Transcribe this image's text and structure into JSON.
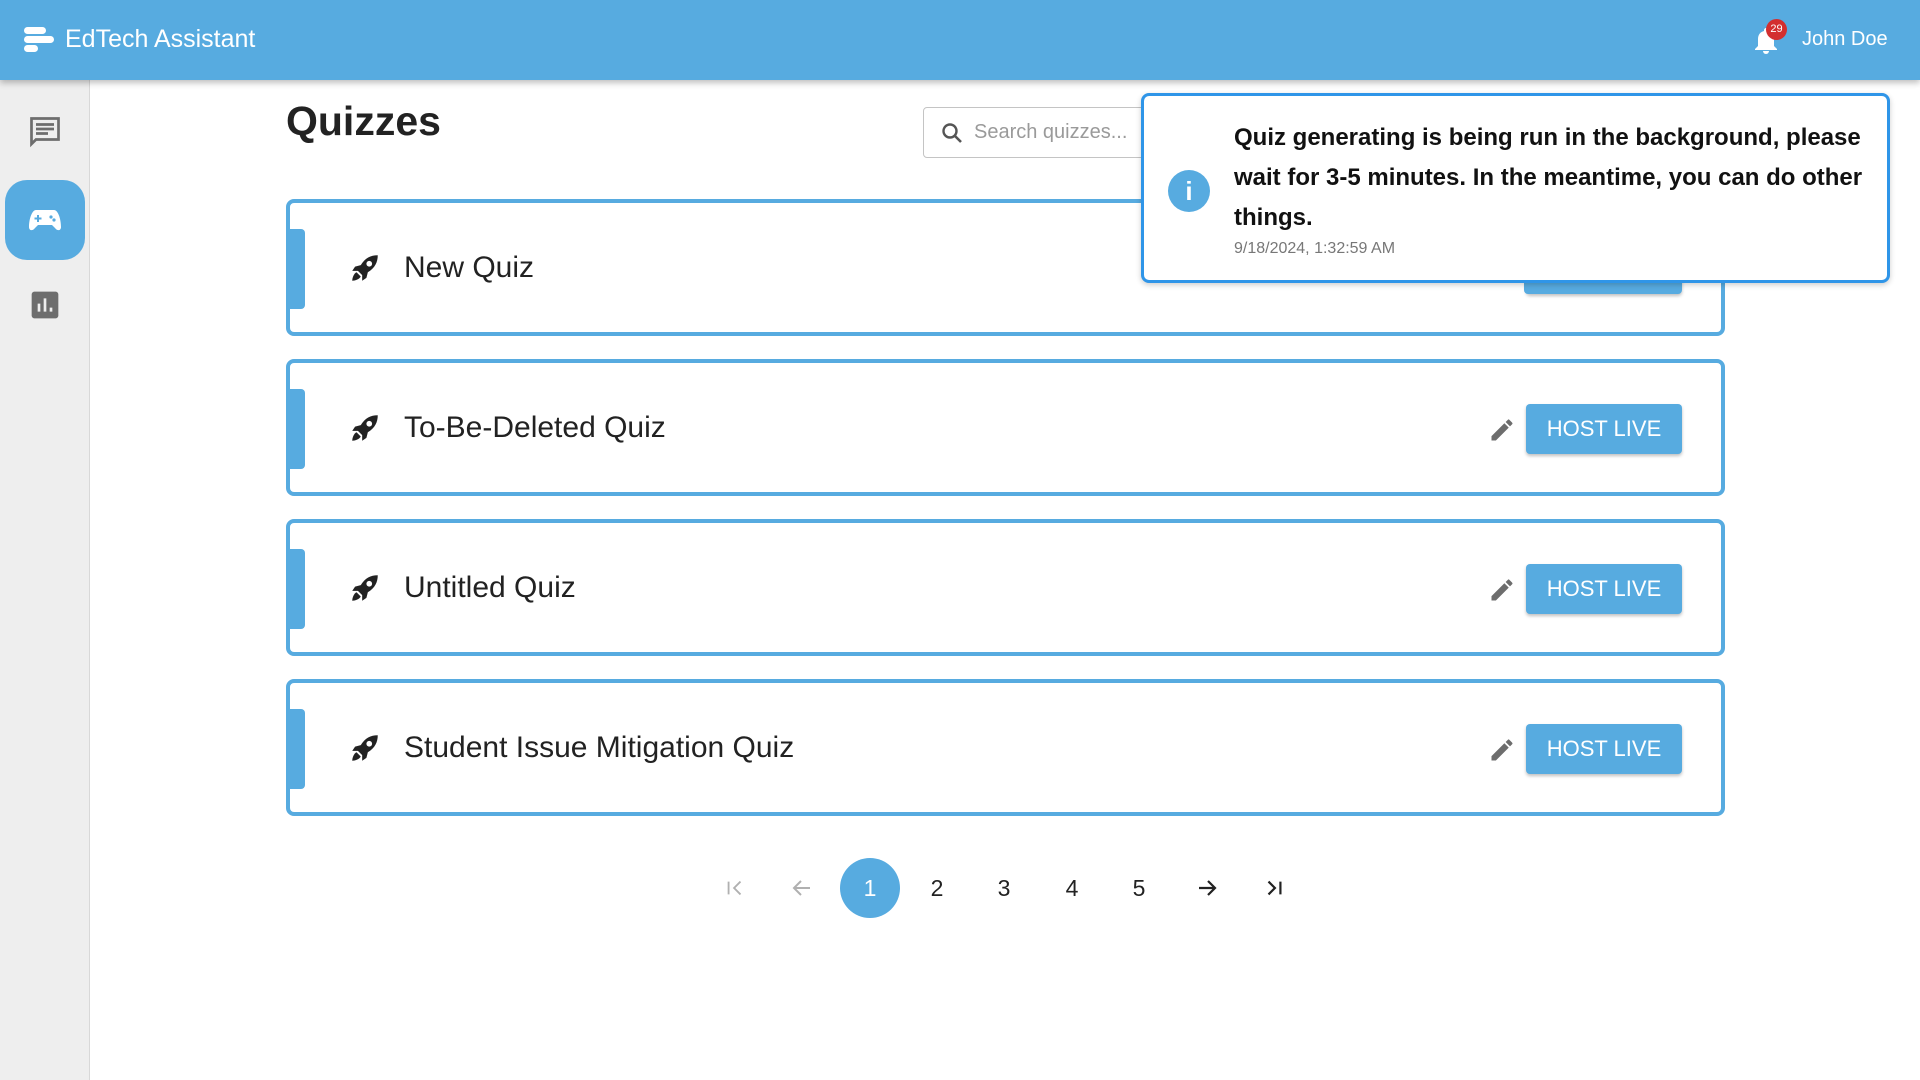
{
  "header": {
    "title": "EdTech Assistant",
    "notification_count": "29",
    "user_name": "John Doe"
  },
  "sidebar": {
    "items": [
      {
        "name": "chat",
        "icon": "chat-icon",
        "active": false
      },
      {
        "name": "quizzes",
        "icon": "gamepad-icon",
        "active": true
      },
      {
        "name": "analytics",
        "icon": "bar-chart-icon",
        "active": false
      }
    ]
  },
  "main": {
    "title": "Quizzes",
    "search": {
      "placeholder": "Search quizzes...",
      "value": ""
    },
    "quizzes": [
      {
        "name": "New Quiz",
        "action": "HOST LIVE"
      },
      {
        "name": "To-Be-Deleted Quiz",
        "action": "HOST LIVE"
      },
      {
        "name": "Untitled Quiz",
        "action": "HOST LIVE"
      },
      {
        "name": "Student Issue Mitigation Quiz",
        "action": "HOST LIVE"
      }
    ],
    "pagination": {
      "pages": [
        "1",
        "2",
        "3",
        "4",
        "5"
      ],
      "current": "1"
    }
  },
  "toast": {
    "message": "Quiz generating is being run in the background, please wait for 3-5 minutes. In the meantime, you can do other things.",
    "timestamp": "9/18/2024, 1:32:59 AM",
    "icon": "info-icon"
  },
  "colors": {
    "primary": "#57abe0",
    "badge": "#d32f2f",
    "toast_border": "#2f95e8"
  }
}
